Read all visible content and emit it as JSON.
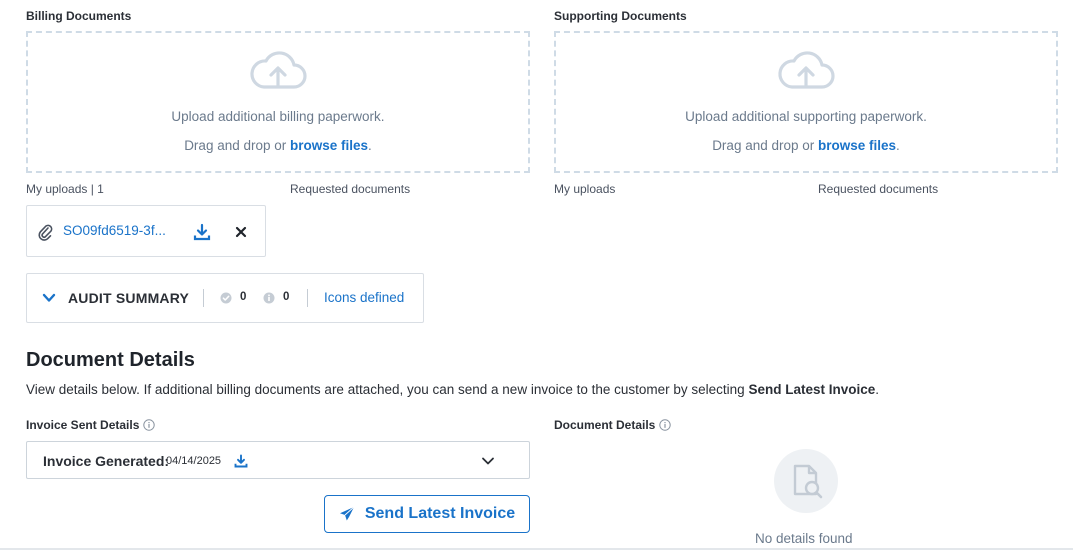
{
  "billing": {
    "label": "Billing Documents",
    "upload_line": "Upload additional billing paperwork.",
    "drag_prefix": "Drag and drop or ",
    "browse": "browse files",
    "period": ".",
    "my_uploads": "My uploads | 1",
    "requested": "Requested documents"
  },
  "supporting": {
    "label": "Supporting Documents",
    "upload_line": "Upload additional supporting paperwork.",
    "drag_prefix": "Drag and drop or ",
    "browse": "browse files",
    "period": ".",
    "my_uploads": "My uploads",
    "requested": "Requested documents"
  },
  "file": {
    "name": "SO09fd6519-3f..."
  },
  "audit": {
    "title": "AUDIT SUMMARY",
    "passed_count": "0",
    "info_count": "0",
    "link": "Icons defined"
  },
  "details": {
    "title": "Document Details",
    "desc_prefix": "View details below. If additional billing documents are attached, you can send a new invoice to the customer by selecting ",
    "desc_bold": "Send Latest Invoice",
    "desc_suffix": ".",
    "invoice_sent_label": "Invoice Sent Details",
    "document_details_label": "Document Details",
    "select_label": "Invoice Generated:",
    "select_date": "04/14/2025",
    "send_button": "Send Latest Invoice",
    "empty_text": "No details found"
  },
  "colors": {
    "accent": "#1a73c9",
    "dashed_border": "#cfdbe6",
    "muted_text": "#6b7a8c"
  }
}
